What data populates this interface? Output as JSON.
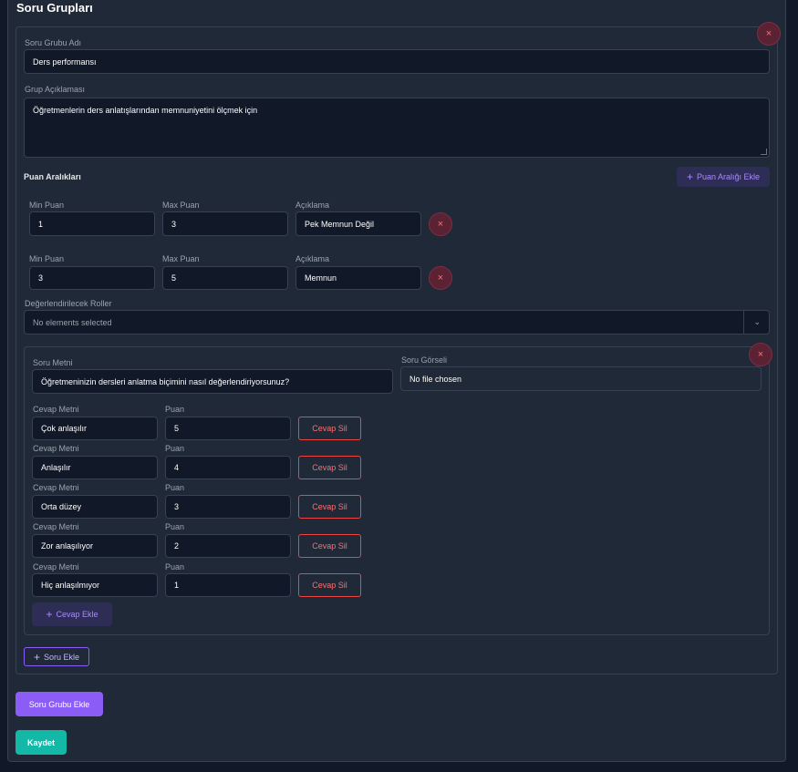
{
  "page": {
    "title": "Soru Grupları"
  },
  "group": {
    "name_label": "Soru Grubu Adı",
    "name_value": "Ders performansı",
    "desc_label": "Grup Açıklaması",
    "desc_value": "Öğretmenlerin ders anlatışlarından memnuniyetini ölçmek için",
    "remove_icon": "×",
    "ranges_heading": "Puan Aralıkları",
    "add_range_label": "Puan Aralığı Ekle",
    "ranges": [
      {
        "min_label": "Min Puan",
        "min": "1",
        "max_label": "Max Puan",
        "max": "3",
        "desc_label": "Açıklama",
        "desc": "Pek Memnun Değil"
      },
      {
        "min_label": "Min Puan",
        "min": "3",
        "max_label": "Max Puan",
        "max": "5",
        "desc_label": "Açıklama",
        "desc": "Memnun"
      }
    ],
    "roles_label": "Değerlendirilecek Roller",
    "roles_placeholder": "No elements selected",
    "question": {
      "text_label": "Soru Metni",
      "text_value": "Öğretmeninizin dersleri anlatma biçimini nasıl değerlendiriyorsunuz?",
      "image_label": "Soru Görseli",
      "image_value": "No file chosen",
      "answers": [
        {
          "text_label": "Cevap Metni",
          "text": "Çok anlaşılır",
          "score_label": "Puan",
          "score": "5",
          "delete_label": "Cevap Sil"
        },
        {
          "text_label": "Cevap Metni",
          "text": "Anlaşılır",
          "score_label": "Puan",
          "score": "4",
          "delete_label": "Cevap Sil"
        },
        {
          "text_label": "Cevap Metni",
          "text": "Orta düzey",
          "score_label": "Puan",
          "score": "3",
          "delete_label": "Cevap Sil"
        },
        {
          "text_label": "Cevap Metni",
          "text": "Zor anlaşılıyor",
          "score_label": "Puan",
          "score": "2",
          "delete_label": "Cevap Sil"
        },
        {
          "text_label": "Cevap Metni",
          "text": "Hiç anlaşılmıyor",
          "score_label": "Puan",
          "score": "1",
          "delete_label": "Cevap Sil"
        }
      ],
      "add_answer_label": "Cevap Ekle"
    },
    "add_question_label": "Soru Ekle"
  },
  "actions": {
    "add_group_label": "Soru Grubu Ekle",
    "save_label": "Kaydet"
  },
  "icons": {
    "plus": "plus-icon",
    "close": "close-icon",
    "chevron": "chevron-down-icon"
  },
  "colors": {
    "accent": "#8b5cf6",
    "save": "#14b8a6",
    "danger": "#ef4444",
    "background": "#111827",
    "card": "#1f2937"
  }
}
